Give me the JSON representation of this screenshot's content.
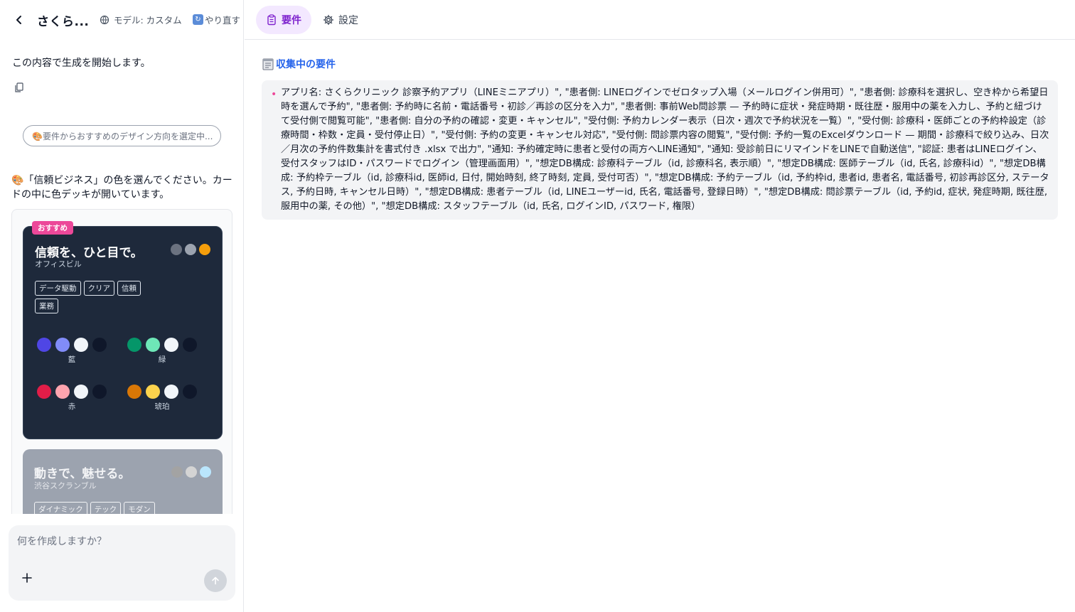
{
  "header": {
    "app_title": "さくら...",
    "model_label": "モデル: カスタム",
    "redo_label": "やり直す"
  },
  "tabs": [
    {
      "label": "要件",
      "active": true
    },
    {
      "label": "設定",
      "active": false
    }
  ],
  "chat": {
    "message": "この内容で生成を開始します。",
    "design_pill": "🎨要件からおすすめのデザイン方向を選定中...",
    "choose_prompt": "🎨「信頼ビジネス」の色を選んでください。カードの中に色デッキが開いています。"
  },
  "cards": [
    {
      "badge": "おすすめ",
      "title": "信頼を、ひと目で。",
      "subtitle": "オフィスビル",
      "header_dots": [
        "#6b7280",
        "#9ca3af",
        "#f59e0b"
      ],
      "tags": [
        "データ駆動",
        "クリア",
        "信頼",
        "業務"
      ],
      "palettes": [
        {
          "name": "藍",
          "colors": [
            "#4f46e5",
            "#818cf8",
            "#f1f5f9",
            "#0f172a"
          ]
        },
        {
          "name": "緑",
          "colors": [
            "#059669",
            "#6ee7b7",
            "#f1f5f9",
            "#0f172a"
          ]
        },
        {
          "name": "赤",
          "colors": [
            "#e11d48",
            "#fda4af",
            "#f1f5f9",
            "#0f172a"
          ]
        },
        {
          "name": "琥珀",
          "colors": [
            "#d97706",
            "#fcd34d",
            "#f1f5f9",
            "#0f172a"
          ]
        }
      ]
    },
    {
      "title": "動きで、魅せる。",
      "subtitle": "渋谷スクランブル",
      "header_dots": [
        "#a3a3a3",
        "#d4d4d4",
        "#bae6fd"
      ],
      "tags": [
        "ダイナミック",
        "テック",
        "モダン"
      ]
    }
  ],
  "composer": {
    "placeholder": "何を作成しますか？"
  },
  "requirements": {
    "heading": "収集中の要件",
    "text": "アプリ名: さくらクリニック 診察予約アプリ（LINEミニアプリ）\", \"患者側: LINEログインでゼロタップ入場（メールログイン併用可）\", \"患者側: 診療科を選択し、空き枠から希望日時を選んで予約\", \"患者側: 予約時に名前・電話番号・初診／再診の区分を入力\", \"患者側: 事前Web問診票 — 予約時に症状・発症時期・既往歴・服用中の薬を入力し、予約と紐づけて受付側で閲覧可能\", \"患者側: 自分の予約の確認・変更・キャンセル\", \"受付側: 予約カレンダー表示（日次・週次で予約状況を一覧）\", \"受付側: 診療科・医師ごとの予約枠設定（診療時間・枠数・定員・受付停止日）\", \"受付側: 予約の変更・キャンセル対応\", \"受付側: 問診票内容の閲覧\", \"受付側: 予約一覧のExcelダウンロード — 期間・診療科で絞り込み、日次／月次の予約件数集計を書式付き .xlsx で出力\", \"通知: 予約確定時に患者と受付の両方へLINE通知\", \"通知: 受診前日にリマインドをLINEで自動送信\", \"認証: 患者はLINEログイン、受付スタッフはID・パスワードでログイン（管理画面用）\", \"想定DB構成: 診療科テーブル（id, 診療科名, 表示順）\", \"想定DB構成: 医師テーブル（id, 氏名, 診療科id）\", \"想定DB構成: 予約枠テーブル（id, 診療科id, 医師id, 日付, 開始時刻, 終了時刻, 定員, 受付可否）\", \"想定DB構成: 予約テーブル（id, 予約枠id, 患者id, 患者名, 電話番号, 初診再診区分, ステータス, 予約日時, キャンセル日時）\", \"想定DB構成: 患者テーブル（id, LINEユーザーid, 氏名, 電話番号, 登録日時）\", \"想定DB構成: 問診票テーブル（id, 予約id, 症状, 発症時期, 既往歴, 服用中の薬, その他）\", \"想定DB構成: スタッフテーブル（id, 氏名, ログインID, パスワード, 権限）"
  }
}
